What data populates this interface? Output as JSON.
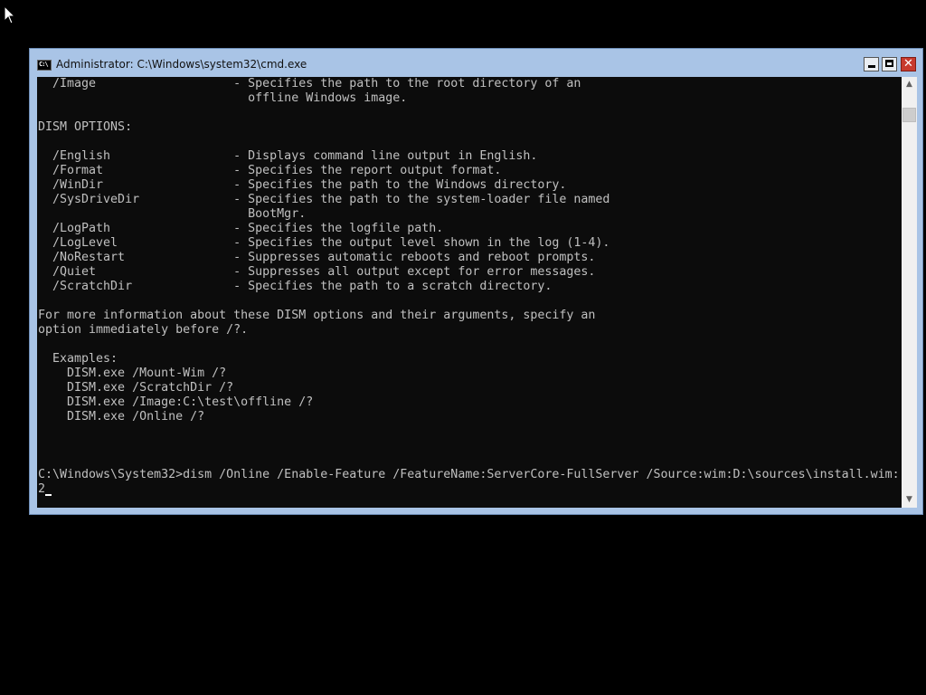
{
  "window": {
    "title": "Administrator: C:\\Windows\\system32\\cmd.exe",
    "icon_label": "C:\\",
    "controls": {
      "minimize": "minimize-icon",
      "maximize": "maximize-icon",
      "close": "close-icon",
      "close_glyph": "✕"
    }
  },
  "console": {
    "lines": [
      "  /Image                   - Specifies the path to the root directory of an",
      "                             offline Windows image.",
      "",
      "DISM OPTIONS:",
      "",
      "  /English                 - Displays command line output in English.",
      "  /Format                  - Specifies the report output format.",
      "  /WinDir                  - Specifies the path to the Windows directory.",
      "  /SysDriveDir             - Specifies the path to the system-loader file named",
      "                             BootMgr.",
      "  /LogPath                 - Specifies the logfile path.",
      "  /LogLevel                - Specifies the output level shown in the log (1-4).",
      "  /NoRestart               - Suppresses automatic reboots and reboot prompts.",
      "  /Quiet                   - Suppresses all output except for error messages.",
      "  /ScratchDir              - Specifies the path to a scratch directory.",
      "",
      "For more information about these DISM options and their arguments, specify an",
      "option immediately before /?.",
      "",
      "  Examples:",
      "    DISM.exe /Mount-Wim /?",
      "    DISM.exe /ScratchDir /?",
      "    DISM.exe /Image:C:\\test\\offline /?",
      "    DISM.exe /Online /?",
      "",
      "",
      "",
      "C:\\Windows\\System32>dism /Online /Enable-Feature /FeatureName:ServerCore-FullServer /Source:wim:D:\\sources\\install.wim:",
      "2"
    ]
  },
  "scrollbar": {
    "up_glyph": "▲",
    "down_glyph": "▼"
  },
  "colors": {
    "console_background": "#0c0c0c",
    "console_text": "#c0c0c0",
    "window_frame": "#a9c4e6",
    "close_button": "#c83a2e",
    "desktop": "#000000"
  }
}
